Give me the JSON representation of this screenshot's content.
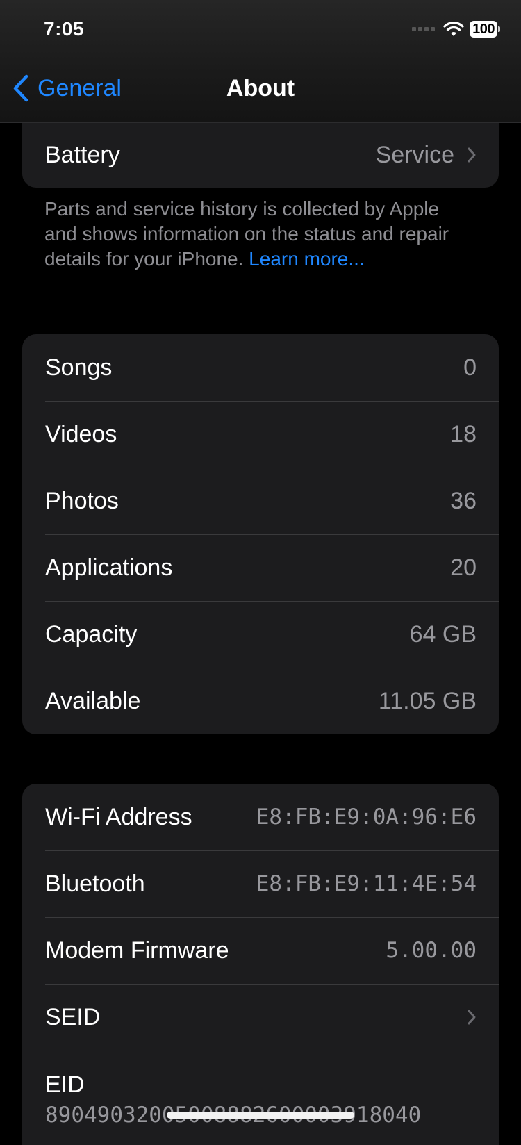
{
  "status_bar": {
    "time": "7:05",
    "battery": "100",
    "icons": [
      "cellular-signal-icon",
      "wifi-icon",
      "battery-icon"
    ]
  },
  "nav": {
    "back_label": "General",
    "title": "About"
  },
  "battery_section": {
    "label": "Battery",
    "value": "Service",
    "footnote": "Parts and service history is collected by Apple and shows information on the status and repair details for your iPhone.",
    "learn_more": "Learn more..."
  },
  "media_section": {
    "rows": [
      {
        "label": "Songs",
        "value": "0"
      },
      {
        "label": "Videos",
        "value": "18"
      },
      {
        "label": "Photos",
        "value": "36"
      },
      {
        "label": "Applications",
        "value": "20"
      },
      {
        "label": "Capacity",
        "value": "64 GB"
      },
      {
        "label": "Available",
        "value": "11.05 GB"
      }
    ]
  },
  "network_section": {
    "rows": [
      {
        "label": "Wi-Fi Address",
        "value": "E8:FB:E9:0A:96:E6"
      },
      {
        "label": "Bluetooth",
        "value": "E8:FB:E9:11:4E:54"
      },
      {
        "label": "Modem Firmware",
        "value": "5.00.00"
      },
      {
        "label": "SEID",
        "value": ""
      },
      {
        "label": "EID",
        "value": "89049032005008882600003918040"
      }
    ]
  },
  "colors": {
    "accent": "#1f87ff",
    "background": "#000000",
    "card": "#1c1c1e",
    "secondary_text": "#98989d"
  }
}
